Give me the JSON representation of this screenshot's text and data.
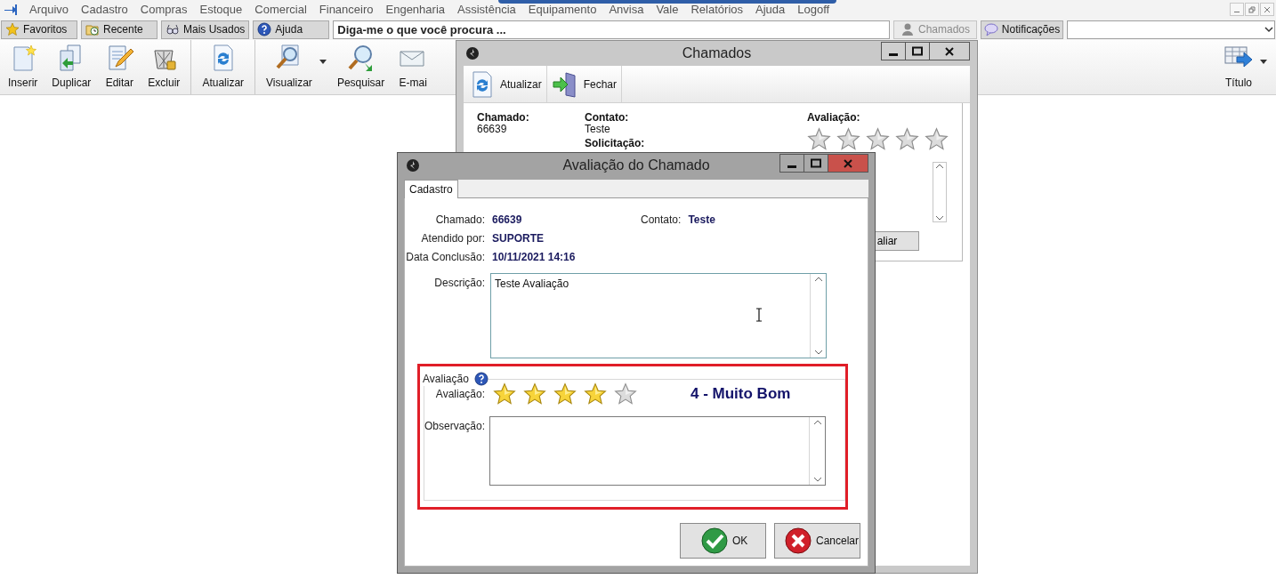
{
  "menu": {
    "items": [
      "Arquivo",
      "Cadastro",
      "Compras",
      "Estoque",
      "Comercial",
      "Financeiro",
      "Engenharia",
      "Assistência",
      "Equipamento",
      "Anvisa",
      "Vale",
      "Relatórios",
      "Ajuda",
      "Logoff"
    ]
  },
  "quick_bar": {
    "buttons": [
      {
        "label": "Favoritos",
        "kind": "star",
        "disabled": false
      },
      {
        "label": "Recente",
        "kind": "recent",
        "disabled": false
      },
      {
        "label": "Mais Usados",
        "kind": "glasses",
        "disabled": false
      },
      {
        "label": "Ajuda",
        "kind": "help",
        "disabled": false
      }
    ],
    "search": {
      "placeholder": "Diga-me o que você procura ..."
    },
    "right_buttons": [
      {
        "label": "Chamados",
        "kind": "person",
        "disabled": true
      },
      {
        "label": "Notificações",
        "kind": "chat",
        "disabled": false
      }
    ]
  },
  "toolbar": {
    "buttons": [
      {
        "label": "Inserir",
        "kind": "new",
        "dropdown": false,
        "separator_before": false
      },
      {
        "label": "Duplicar",
        "kind": "copy",
        "dropdown": false,
        "separator_before": false
      },
      {
        "label": "Editar",
        "kind": "edit",
        "dropdown": false,
        "separator_before": false
      },
      {
        "label": "Excluir",
        "kind": "delete",
        "dropdown": false,
        "separator_before": false
      },
      {
        "label": "Atualizar",
        "kind": "refresh",
        "dropdown": false,
        "separator_before": true
      },
      {
        "label": "Visualizar",
        "kind": "view",
        "dropdown": true,
        "separator_before": true
      },
      {
        "label": "Pesquisar",
        "kind": "search",
        "dropdown": false,
        "separator_before": false
      },
      {
        "label": "E-mai",
        "kind": "mail",
        "dropdown": false,
        "separator_before": false
      }
    ],
    "right_button": {
      "label": "Título",
      "dropdown": true
    }
  },
  "chamados_window": {
    "title": "Chamados",
    "toolbar": [
      {
        "label": "Atualizar",
        "kind": "refresh"
      },
      {
        "label": "Fechar",
        "kind": "exit"
      }
    ],
    "fields": [
      {
        "label": "Chamado:",
        "value": "66639"
      },
      {
        "label": "Contato:",
        "value": "Teste"
      }
    ],
    "request_label": "Solicitação:",
    "rating": {
      "label": "Avaliação:",
      "stars": 0
    },
    "button": {
      "label": "aliar"
    }
  },
  "dialog": {
    "title": "Avaliação do Chamado",
    "tabs": [
      {
        "label": "Cadastro",
        "selected": true
      }
    ],
    "rows": [
      {
        "fields": [
          {
            "label": "Chamado:",
            "value": "66639"
          },
          {
            "label": "Contato:",
            "value": "Teste"
          }
        ]
      },
      {
        "fields": [
          {
            "label": "Atendido por:",
            "value": "SUPORTE"
          }
        ]
      },
      {
        "fields": [
          {
            "label": "Data Conclusão:",
            "value": "10/11/2021 14:16"
          }
        ]
      }
    ],
    "description": {
      "label": "Descrição:",
      "value": "Teste Avaliação"
    },
    "rating_group": {
      "title": "Avaliação",
      "rating": {
        "label": "Avaliação:",
        "stars": 4,
        "text": "4 - Muito Bom"
      },
      "observation": {
        "label": "Observação:"
      }
    },
    "buttons": [
      {
        "label": "OK",
        "kind": "ok"
      },
      {
        "label": "Cancelar",
        "kind": "cancel"
      }
    ]
  }
}
